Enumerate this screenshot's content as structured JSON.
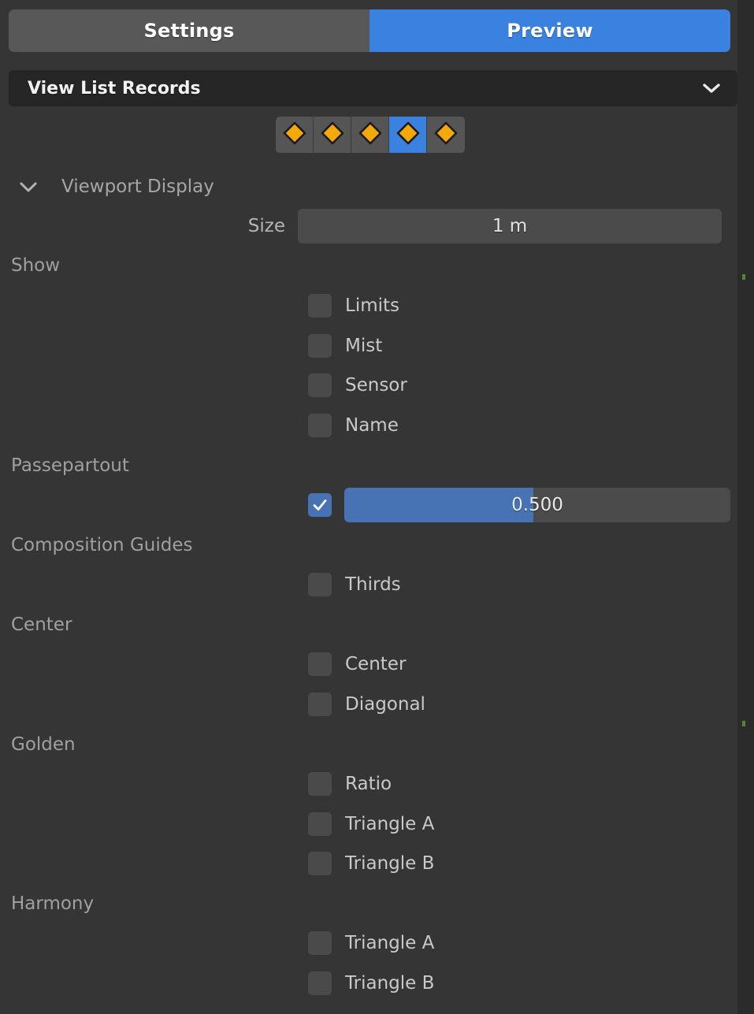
{
  "colors": {
    "panel_bg": "#353535",
    "accent_blue": "#3b82e0",
    "slider_blue": "#4772b3",
    "keyframe_gold": "#f5a80a",
    "field_gray": "#4b4b4b",
    "edge_dark": "#2b2b2b"
  },
  "tabs": [
    {
      "label": "Settings",
      "active": false
    },
    {
      "label": "Preview",
      "active": true
    }
  ],
  "datablock": {
    "name": "View List Records",
    "chevron_icon": "chevron-down-icon"
  },
  "keyframe_row": {
    "icon": "keyframe-diamond-icon",
    "count": 5,
    "selected_index": 3
  },
  "section": {
    "title": "Viewport Display",
    "expanded": true,
    "chevron_icon": "chevron-down-icon"
  },
  "size": {
    "label": "Size",
    "value": "1 m"
  },
  "show": {
    "label": "Show",
    "items": [
      {
        "label": "Limits",
        "checked": false
      },
      {
        "label": "Mist",
        "checked": false
      },
      {
        "label": "Sensor",
        "checked": false
      },
      {
        "label": "Name",
        "checked": false
      }
    ]
  },
  "passepartout": {
    "label": "Passepartout",
    "enabled": true,
    "value": "0.500",
    "fill_percent": 49
  },
  "composition_guides": {
    "label": "Composition Guides",
    "items": [
      {
        "label": "Thirds",
        "checked": false
      }
    ]
  },
  "center": {
    "label": "Center",
    "items": [
      {
        "label": "Center",
        "checked": false
      },
      {
        "label": "Diagonal",
        "checked": false
      }
    ]
  },
  "golden": {
    "label": "Golden",
    "items": [
      {
        "label": "Ratio",
        "checked": false
      },
      {
        "label": "Triangle A",
        "checked": false
      },
      {
        "label": "Triangle B",
        "checked": false
      }
    ]
  },
  "harmony": {
    "label": "Harmony",
    "items": [
      {
        "label": "Triangle A",
        "checked": false
      },
      {
        "label": "Triangle B",
        "checked": false
      }
    ]
  }
}
